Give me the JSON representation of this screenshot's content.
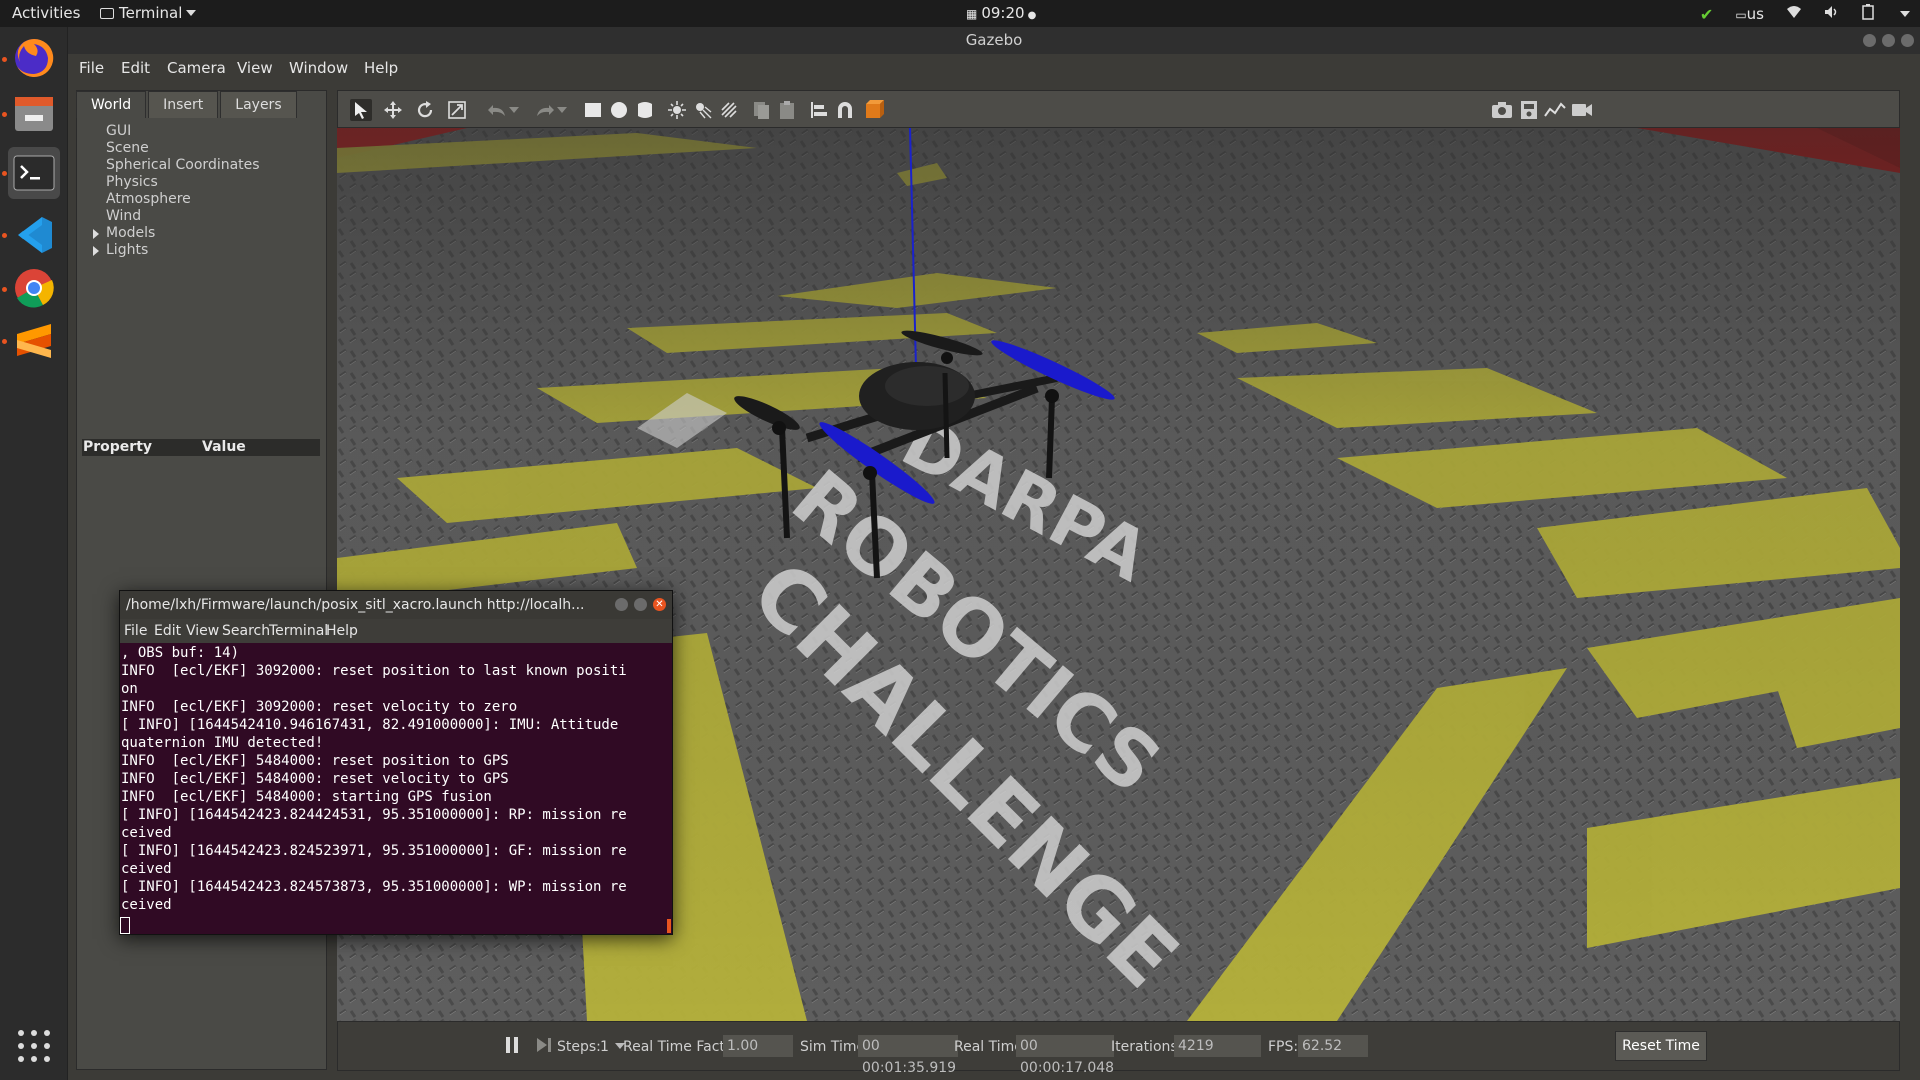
{
  "topbar": {
    "activities": "Activities",
    "app_name": "Terminal",
    "clock": "09:20",
    "keyboard": "us"
  },
  "gazebo": {
    "title": "Gazebo",
    "menu": [
      "File",
      "Edit",
      "Camera",
      "View",
      "Window",
      "Help"
    ],
    "tabs": [
      "World",
      "Insert",
      "Layers"
    ],
    "tree": [
      "GUI",
      "Scene",
      "Spherical Coordinates",
      "Physics",
      "Atmosphere",
      "Wind",
      "Models",
      "Lights"
    ],
    "property_header": "Property",
    "value_header": "Value",
    "status": {
      "steps_label": "Steps:",
      "steps_value": "1",
      "rtf_label": "Real Time Factor:",
      "rtf_value": "1.00",
      "sim_time_label": "Sim Time:",
      "sim_time_value": "00 00:01:35.919",
      "real_time_label": "Real Time:",
      "real_time_value": "00 00:00:17.048",
      "iterations_label": "Iterations:",
      "iterations_value": "4219",
      "fps_label": "FPS:",
      "fps_value": "62.52",
      "reset_label": "Reset Time"
    }
  },
  "terminal": {
    "title": "/home/lxh/Firmware/launch/posix_sitl_xacro.launch http://localh...",
    "menu": [
      "File",
      "Edit",
      "View",
      "Search",
      "Terminal",
      "Help"
    ],
    "lines": [
      ", OBS buf: 14)",
      "INFO  [ecl/EKF] 3092000: reset position to last known positi",
      "on",
      "INFO  [ecl/EKF] 3092000: reset velocity to zero",
      "[ INFO] [1644542410.946167431, 82.491000000]: IMU: Attitude",
      "quaternion IMU detected!",
      "INFO  [ecl/EKF] 5484000: reset position to GPS",
      "INFO  [ecl/EKF] 5484000: reset velocity to GPS",
      "INFO  [ecl/EKF] 5484000: starting GPS fusion",
      "[ INFO] [1644542423.824424531, 95.351000000]: RP: mission re",
      "ceived",
      "[ INFO] [1644542423.824523971, 95.351000000]: GF: mission re",
      "ceived",
      "[ INFO] [1644542423.824573873, 95.351000000]: WP: mission re",
      "ceived"
    ]
  },
  "scene": {
    "floor_text_1": "DARPA",
    "floor_text_2": "ROBOTICS",
    "floor_text_3": "CHALLENGE",
    "colors": {
      "floor": "#5a5a5a",
      "stripe": "#b8b43a",
      "wall": "#b01818",
      "propeller": "#1a1acc"
    }
  }
}
